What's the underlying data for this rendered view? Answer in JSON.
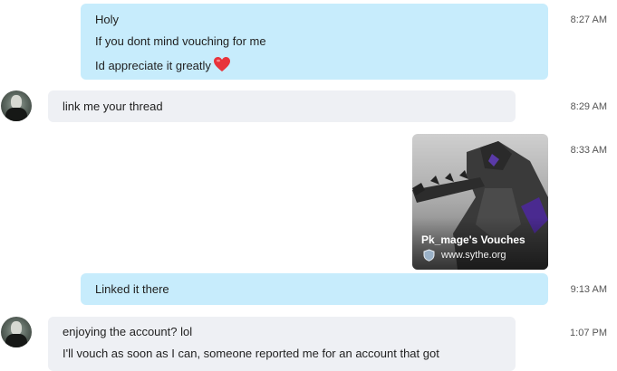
{
  "messages": [
    {
      "direction": "outgoing",
      "lines": [
        "Holy",
        "If you dont mind vouching for me",
        "Id appreciate it greatly"
      ],
      "emoji": "heart",
      "time": "8:27 AM"
    },
    {
      "direction": "incoming",
      "lines": [
        "link me your thread"
      ],
      "time": "8:29 AM"
    },
    {
      "direction": "outgoing",
      "type": "link-preview",
      "title": "Pk_mage's Vouches",
      "url": "www.sythe.org",
      "time": "8:33 AM"
    },
    {
      "direction": "outgoing",
      "lines": [
        "Linked it there"
      ],
      "time": "9:13 AM"
    },
    {
      "direction": "incoming",
      "lines": [
        "enjoying the account? lol",
        "I'll vouch as soon as I can, someone reported me for an account that got"
      ],
      "time": "1:07 PM"
    }
  ],
  "colors": {
    "outgoing_bubble": "#c7ecfc",
    "incoming_bubble": "#eef0f4",
    "heart": "#e8333b"
  }
}
